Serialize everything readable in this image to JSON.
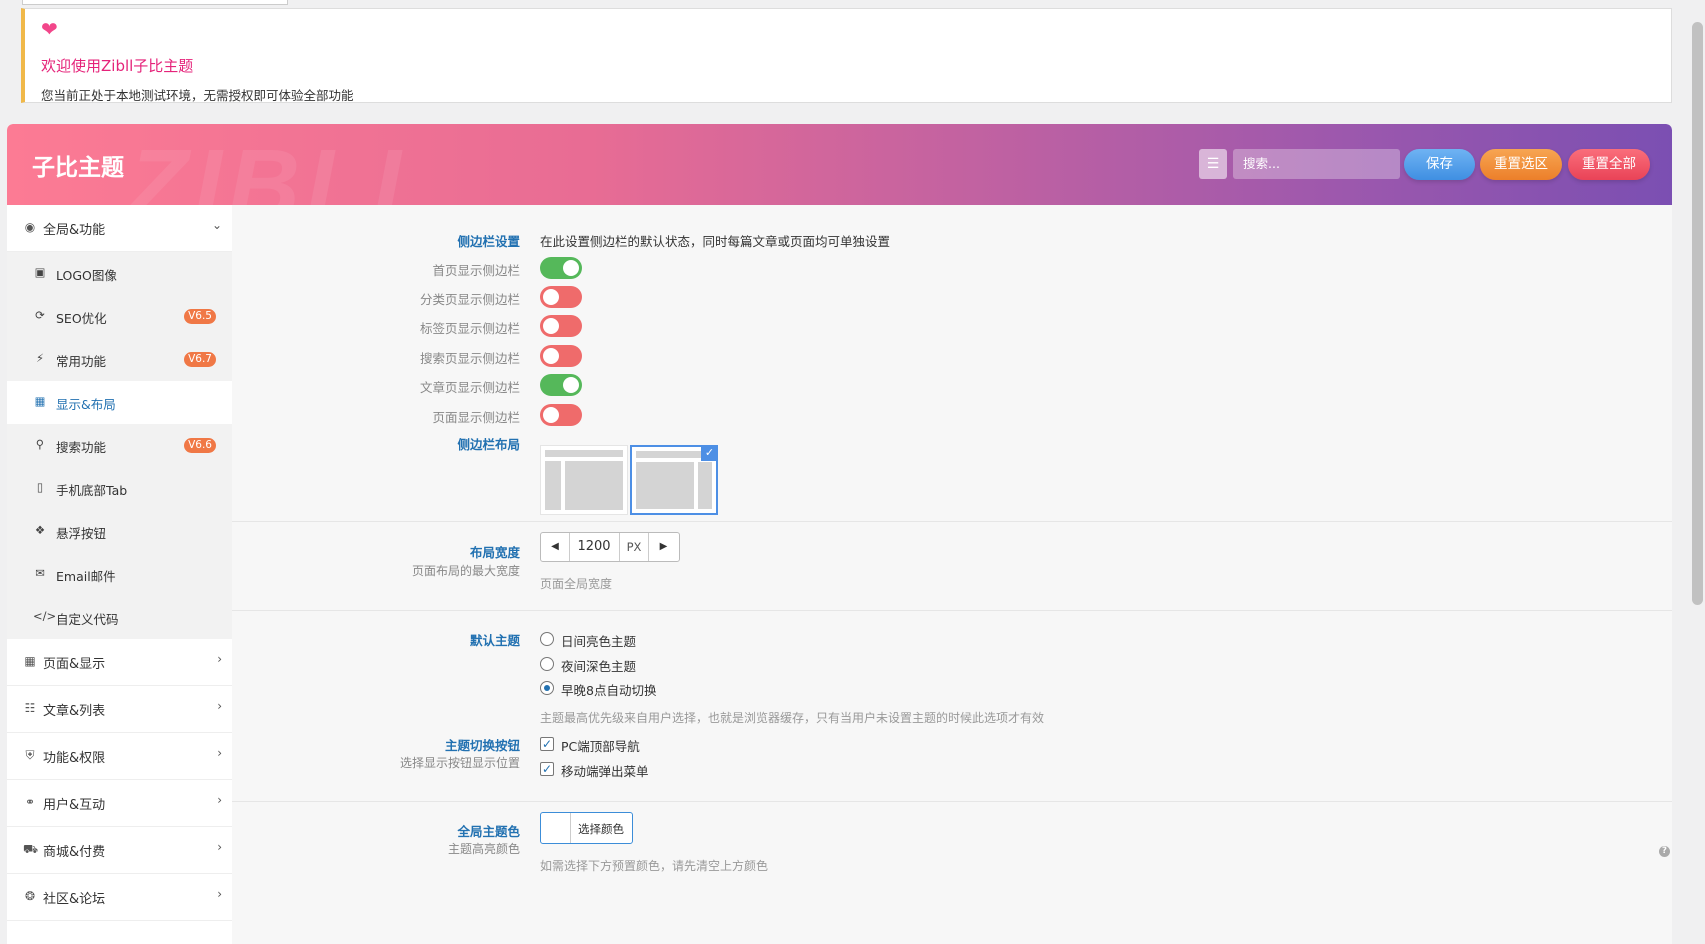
{
  "notice": {
    "title": "欢迎使用Zibll子比主题",
    "desc": "您当前正处于本地测试环境，无需授权即可体验全部功能"
  },
  "header": {
    "title": "子比主题",
    "watermark": "ZIBLL",
    "search_placeholder": "搜索...",
    "save": "保存",
    "reset_section": "重置选区",
    "reset_all": "重置全部"
  },
  "colors": {
    "accent": "#2271b1",
    "toggle_on": "#55b85a",
    "toggle_off": "#ef6b6b",
    "badge": "#f07846",
    "notice_title": "#e5237a"
  },
  "sidebar": {
    "items": [
      {
        "label": "全局&功能",
        "icon": "globe-icon",
        "expanded": true
      },
      {
        "label": "页面&显示",
        "icon": "calendar-icon"
      },
      {
        "label": "文章&列表",
        "icon": "map-icon"
      },
      {
        "label": "功能&权限",
        "icon": "shield-icon"
      },
      {
        "label": "用户&互动",
        "icon": "user-icon"
      },
      {
        "label": "商城&付费",
        "icon": "cart-icon"
      },
      {
        "label": "社区&论坛",
        "icon": "compass-icon"
      }
    ],
    "sub": [
      {
        "label": "LOGO图像",
        "icon": "image-icon"
      },
      {
        "label": "SEO优化",
        "icon": "refresh-icon",
        "badge": "V6.5"
      },
      {
        "label": "常用功能",
        "icon": "bolt-icon",
        "badge": "V6.7"
      },
      {
        "label": "显示&布局",
        "icon": "layout-icon",
        "active": true
      },
      {
        "label": "搜索功能",
        "icon": "search-icon",
        "badge": "V6.6"
      },
      {
        "label": "手机底部Tab",
        "icon": "mobile-icon"
      },
      {
        "label": "悬浮按钮",
        "icon": "pin-icon"
      },
      {
        "label": "Email邮件",
        "icon": "mail-icon"
      },
      {
        "label": "自定义代码",
        "icon": "code-icon"
      }
    ]
  },
  "content": {
    "sidebar_settings": {
      "label": "侧边栏设置",
      "desc": "在此设置侧边栏的默认状态，同时每篇文章或页面均可单独设置",
      "toggles": [
        {
          "label": "首页显示侧边栏",
          "on": true
        },
        {
          "label": "分类页显示侧边栏",
          "on": false
        },
        {
          "label": "标签页显示侧边栏",
          "on": false
        },
        {
          "label": "搜索页显示侧边栏",
          "on": false
        },
        {
          "label": "文章页显示侧边栏",
          "on": true
        },
        {
          "label": "页面显示侧边栏",
          "on": false
        }
      ]
    },
    "sidebar_layout": {
      "label": "侧边栏布局",
      "selected": "right-sidebar"
    },
    "layout_width": {
      "label": "布局宽度",
      "sublabel": "页面布局的最大宽度",
      "value": "1200",
      "unit": "PX",
      "hint": "页面全局宽度"
    },
    "default_theme": {
      "label": "默认主题",
      "options": [
        "日间亮色主题",
        "夜间深色主题",
        "早晚8点自动切换"
      ],
      "selected": 2,
      "hint": "主题最高优先级来自用户选择，也就是浏览器缓存，只有当用户未设置主题的时候此选项才有效"
    },
    "theme_switch": {
      "label": "主题切换按钮",
      "sublabel": "选择显示按钮显示位置",
      "options": [
        {
          "label": "PC端顶部导航",
          "checked": true
        },
        {
          "label": "移动端弹出菜单",
          "checked": true
        }
      ]
    },
    "theme_color": {
      "label": "全局主题色",
      "sublabel": "主题高亮颜色",
      "button": "选择颜色",
      "hint": "如需选择下方预置颜色，请先清空上方颜色"
    }
  }
}
